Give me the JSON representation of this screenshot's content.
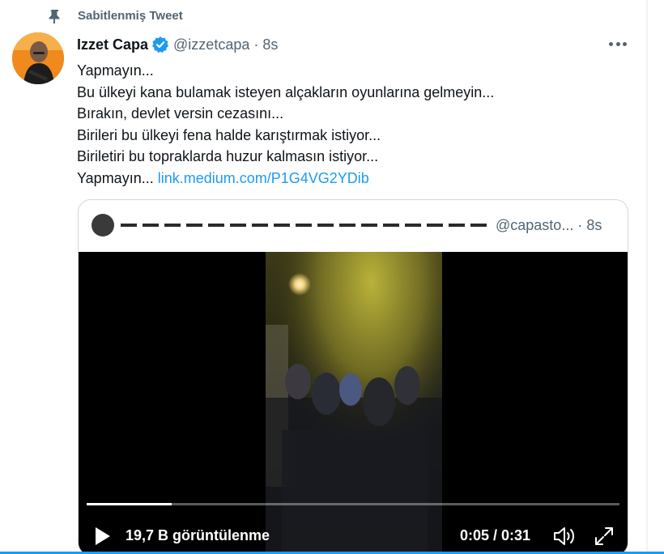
{
  "pinned": {
    "label": "Sabitlenmiş Tweet",
    "icon": "pin-icon"
  },
  "tweet": {
    "author_name": "Izzet Capa",
    "verified_icon": "verified-badge-icon",
    "handle": "@izzetcapa",
    "separator": "·",
    "time": "8s",
    "lines": [
      "Yapmayın...",
      "Bu ülkeyi kana bulamak isteyen alçakların oyunlarına gelmeyin...",
      "Bırakın, devlet versin cezasını...",
      "Birileri bu ülkeyi fena halde karıştırmak istiyor...",
      "Biriletiri bu topraklarda huzur kalmasın istiyor..."
    ],
    "last_line_text": "Yapmayın... ",
    "link": "link.medium.com/P1G4VG2YDib",
    "more_icon": "more-icon"
  },
  "quote": {
    "handle": "@capasto...",
    "separator": "·",
    "time": "8s",
    "video": {
      "views": "19,7 B görüntülenme",
      "duration": "0:05 / 0:31",
      "progress": 0.16,
      "icons": [
        "play-icon",
        "volume-icon",
        "fullscreen-icon"
      ]
    }
  },
  "colors": {
    "accent": "#1d9bf0",
    "secondary_text": "#536471",
    "border": "#cfd9de"
  }
}
